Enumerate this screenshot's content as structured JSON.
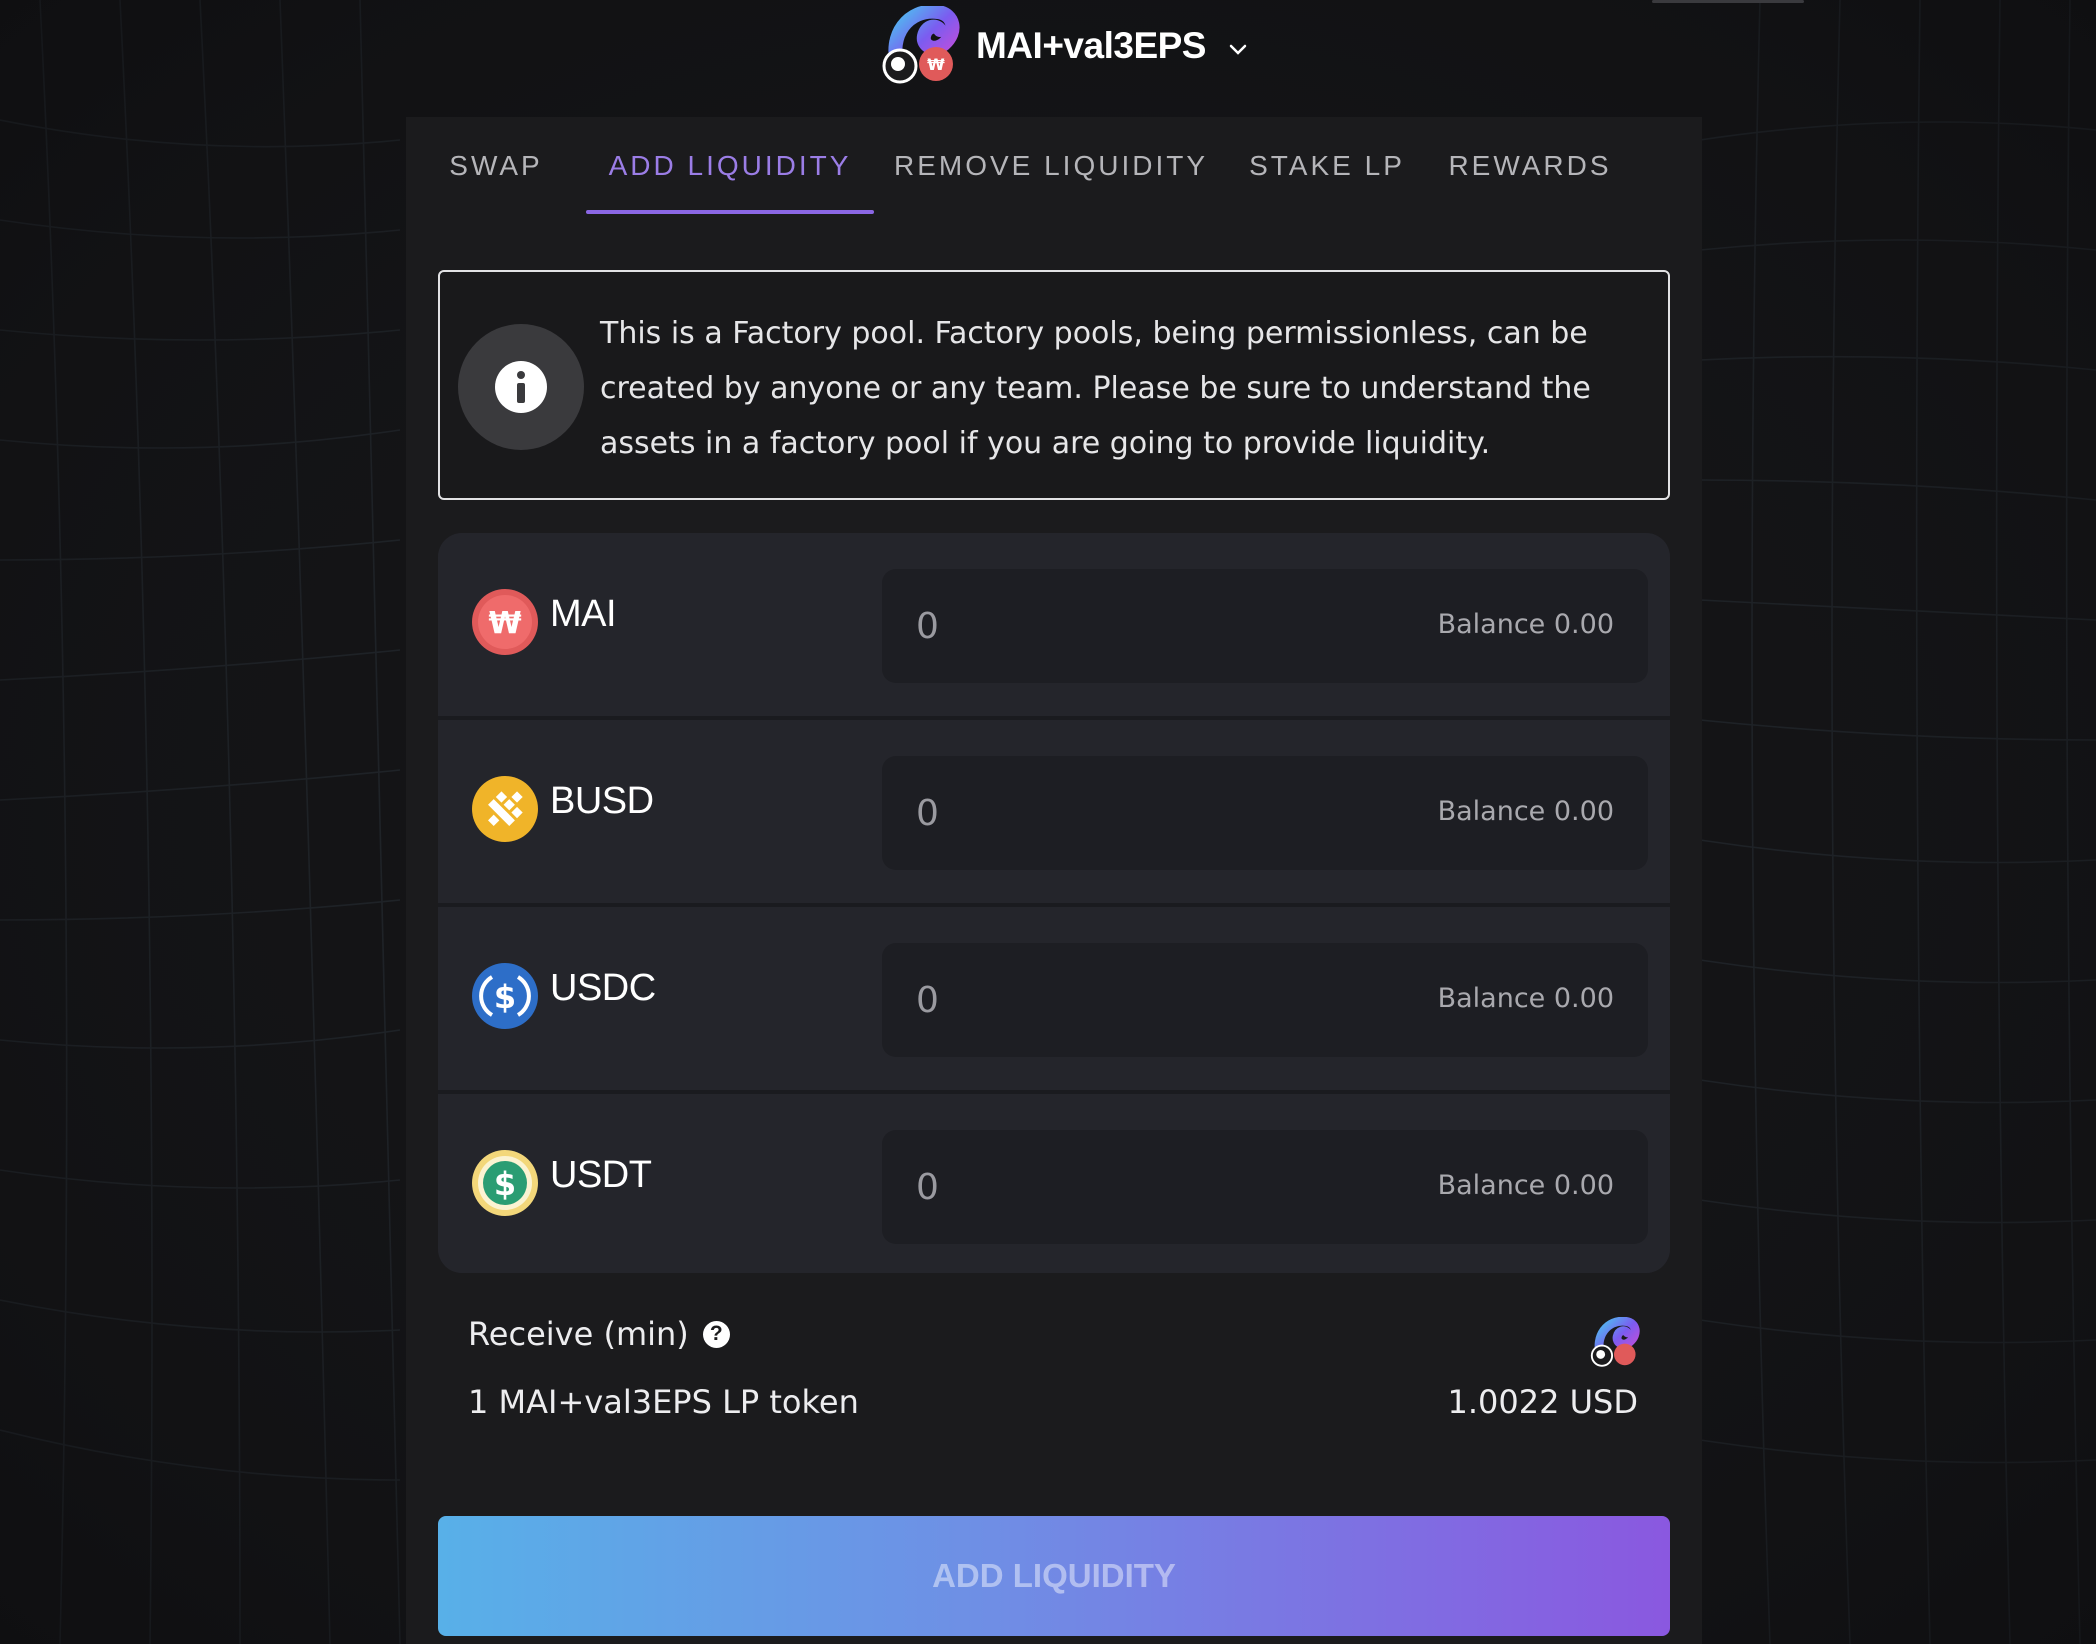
{
  "pool": {
    "name": "MAI+val3EPS",
    "logo_icon": "mai-val3eps-pool-icon"
  },
  "tabs": [
    {
      "label": "SWAP",
      "active": false
    },
    {
      "label": "ADD LIQUIDITY",
      "active": true
    },
    {
      "label": "REMOVE LIQUIDITY",
      "active": false
    },
    {
      "label": "STAKE LP",
      "active": false
    },
    {
      "label": "REWARDS",
      "active": false
    }
  ],
  "notice": {
    "icon": "info-icon",
    "text": "This is a Factory pool. Factory pools, being permissionless, can be created by anyone or any team. Please be sure to understand the assets in a factory pool if you are going to provide liquidity."
  },
  "tokens": [
    {
      "symbol": "MAI",
      "icon": "mai-icon",
      "amount": "0",
      "balance": "Balance 0.00",
      "color": "#e05a5a"
    },
    {
      "symbol": "BUSD",
      "icon": "busd-icon",
      "amount": "0",
      "balance": "Balance 0.00",
      "color": "#f0b429"
    },
    {
      "symbol": "USDC",
      "icon": "usdc-icon",
      "amount": "0",
      "balance": "Balance 0.00",
      "color": "#2d6ec8"
    },
    {
      "symbol": "USDT",
      "icon": "usdt-icon",
      "amount": "0",
      "balance": "Balance 0.00",
      "color": "#2a9d73"
    }
  ],
  "receive": {
    "label": "Receive (min)",
    "help_icon": "?",
    "lp_amount": "1 MAI+val3EPS LP token",
    "usd_value": "1.0022 USD"
  },
  "action": {
    "button_label": "ADD LIQUIDITY"
  },
  "colors": {
    "accent": "#8b67e4",
    "background": "#141416",
    "panel": "#1b1b1d"
  }
}
